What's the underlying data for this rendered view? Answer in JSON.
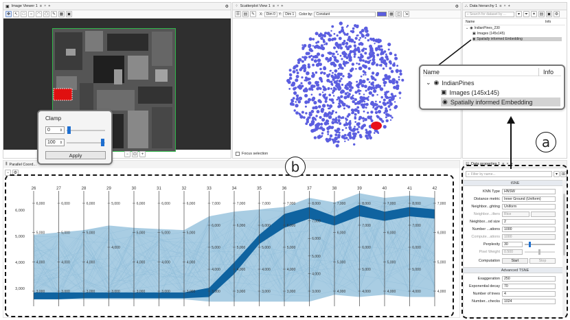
{
  "image_viewer": {
    "tab_title": "Image Viewer 1",
    "tab_close": "×",
    "tab_add": "+",
    "toolbar_icons": [
      "cursor-icon",
      "pointer-icon",
      "rect-select-icon",
      "ellipse-select-icon",
      "lasso-icon",
      "polygon-icon",
      "brush-icon",
      "stamp-icon",
      "flood-icon"
    ],
    "zoom_buttons": [
      "zoom-out-icon",
      "zoom-fit-icon",
      "zoom-in-icon"
    ]
  },
  "clamp_popup": {
    "title": "Clamp",
    "min_value": "0",
    "max_value": "100",
    "apply_label": "Apply",
    "min_slider_fraction": 0.02,
    "max_slider_fraction": 0.98
  },
  "scatterplot": {
    "tab_title": "Scatterplot View 1",
    "tab_close": "×",
    "tab_add": "+",
    "x_label": "X:",
    "x_dim": "Dim 0",
    "y_label": "Y:",
    "y_dim": "Dim 1",
    "color_by_label": "Color by:",
    "color_by_value": "Constant",
    "point_color": "#5b5ee0",
    "selection_color": "#e8101a",
    "focus_selection": "Focus selection"
  },
  "hierarchy_small": {
    "tab_title": "Data hierarchy 1",
    "tab_close": "×",
    "tab_add": "+",
    "search_placeholder": "Search for dataset by ...",
    "col_name": "Name",
    "col_info": "Info",
    "items": [
      "IndianPines_230",
      "Images (145x145)",
      "Spatially informed Embedding"
    ]
  },
  "hierarchy_zoom": {
    "col_name": "Name",
    "col_info": "Info",
    "items": [
      "IndianPines",
      "Images (145x145)",
      "Spatially informed Embedding"
    ]
  },
  "labels": {
    "a": "a",
    "b": "b"
  },
  "pcp_panel": {
    "tab_title": "Parallel Coord..."
  },
  "parallel_coords": {
    "axes": [
      "26",
      "27",
      "28",
      "29",
      "30",
      "31",
      "32",
      "33",
      "34",
      "35",
      "36",
      "37",
      "38",
      "39",
      "40",
      "41",
      "42"
    ],
    "axis_ticks": [
      [
        "6,000",
        "5,000",
        "4,000",
        "3,000"
      ],
      [
        "6,000",
        "5,000",
        "4,000",
        "3,000"
      ],
      [
        "6,000",
        "5,000",
        "4,000",
        "3,000"
      ],
      [
        "5,000",
        "4,000",
        "3,000"
      ],
      [
        "6,000",
        "5,000",
        "4,000",
        "3,000"
      ],
      [
        "6,000",
        "5,000",
        "4,000",
        "3,000"
      ],
      [
        "6,000",
        "5,000",
        "4,000",
        "3,000"
      ],
      [
        "7,000",
        "6,000",
        "5,000",
        "4,000",
        "3,000"
      ],
      [
        "7,000",
        "6,000",
        "5,000",
        "4,000",
        "3,000"
      ],
      [
        "7,000",
        "6,000",
        "5,000",
        "4,000",
        "3,000"
      ],
      [
        "7,000",
        "6,000",
        "5,000",
        "4,000",
        "3,000"
      ],
      [
        "8,000",
        "7,000",
        "6,000",
        "5,000",
        "4,000",
        "3,000"
      ],
      [
        "7,000",
        "6,000",
        "5,000",
        "4,000"
      ],
      [
        "8,000",
        "7,000",
        "6,000",
        "5,000",
        "4,000"
      ],
      [
        "7,000",
        "6,000",
        "5,000",
        "4,000"
      ],
      [
        "8,000",
        "7,000",
        "6,000",
        "5,000",
        "4,000"
      ],
      [
        "7,000",
        "6,000",
        "5,000",
        "4,000"
      ]
    ],
    "left_axis_ticks": [
      "6,000",
      "5,000",
      "4,000",
      "3,000"
    ],
    "context_color": "#a9cde3",
    "highlight_color": "#0f63a0"
  },
  "data_props": {
    "tab_title": "Data properties 1",
    "tab_close": "×",
    "tab_add": "+",
    "filter_placeholder": "Filter by name...",
    "section_tsne": "tSNE",
    "section_advanced": "Advanced TSNE",
    "rows": [
      {
        "label": "KNN Type",
        "value": "HNSW",
        "dim": false
      },
      {
        "label": "Distance metric",
        "value": "Inner Ground (Uniform)",
        "dim": false
      },
      {
        "label": "Neighbor...ghting",
        "value": "Uniform",
        "dim": false
      },
      {
        "label": "Neighbor...ilters",
        "value": "Rice",
        "dim": true
      },
      {
        "label": "Neighbor...od size",
        "value": "2",
        "dim": false
      },
      {
        "label": "Number ...ations",
        "value": "1000",
        "dim": false
      },
      {
        "label": "Compute...ations",
        "value": "1000",
        "dim": true
      },
      {
        "label": "Perplexity",
        "value": "30",
        "dim": false
      },
      {
        "label": "Pixel Weight",
        "value": "0.500",
        "dim": true
      }
    ],
    "computation_label": "Computation",
    "start_label": "Start",
    "stop_label": "Stop",
    "advanced_rows": [
      {
        "label": "Exaggeration",
        "value": "250"
      },
      {
        "label": "Exponential decay",
        "value": "70"
      },
      {
        "label": "Number of trees",
        "value": "4"
      },
      {
        "label": "Number...checks",
        "value": "1024"
      }
    ]
  }
}
